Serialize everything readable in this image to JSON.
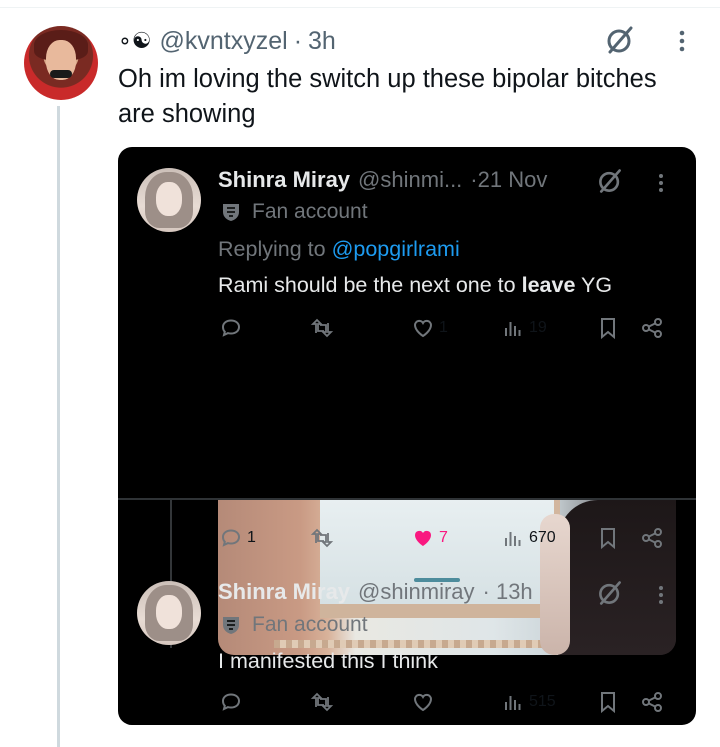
{
  "tweet": {
    "handle": "@kvntxyzel",
    "time": "3h",
    "text": "Oh im loving the switch up these bipolar bitches are showing",
    "header_glyphs": "∘☯"
  },
  "embed": {
    "post1": {
      "name": "Shinra Miray",
      "handle": "@shinmi...",
      "time": "·21 Nov",
      "badge": "Fan account",
      "replying_label": "Replying to",
      "replying_to": "@popgirlrami",
      "text_before": "Rami should be the next one to ",
      "text_bold": "leave",
      "text_after": " YG",
      "likes": "1",
      "views": "19"
    },
    "post2_stats": {
      "replies": "1",
      "likes": "7",
      "views": "670"
    },
    "post3": {
      "name": "Shinra Miray",
      "handle": "@shinmiray",
      "time": "· 13h",
      "badge": "Fan account",
      "text": "I manifested this I think",
      "views": "515"
    },
    "colors": {
      "background": "#000000",
      "text": "#e7e9ea",
      "muted": "#71767b",
      "link": "#1d9bf0",
      "like_active": "#f91880"
    }
  },
  "icons": [
    "grok-icon",
    "more-icon",
    "reply-icon",
    "retweet-icon",
    "heart-icon",
    "views-icon",
    "bookmark-icon",
    "share-icon",
    "shield-icon"
  ]
}
